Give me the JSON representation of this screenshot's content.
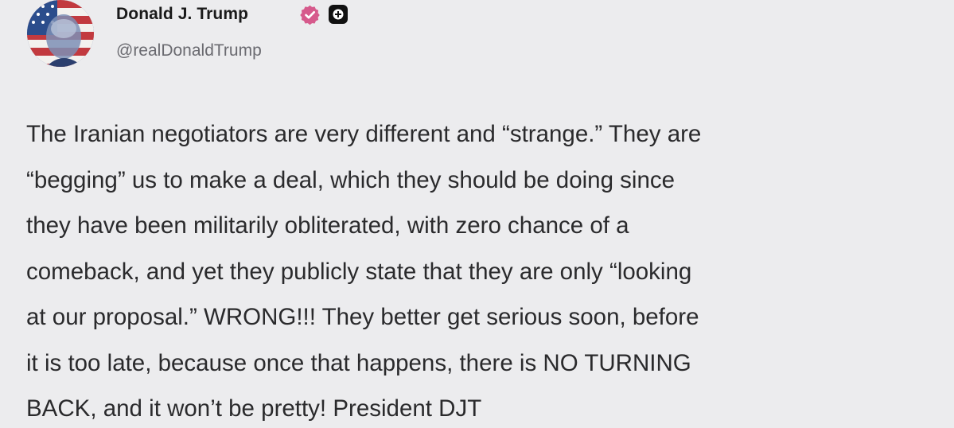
{
  "post": {
    "author_name": "Donald J. Trump",
    "handle": "@realDonaldTrump",
    "body_lines": [
      "The Iranian negotiators are very different and “strange.” They are",
      "“begging” us to make a deal, which they should be doing since",
      "they have been militarily obliterated, with zero chance of a",
      "comeback, and yet they publicly state that they are only “looking",
      "at our proposal.” WRONG!!! They better get serious soon, before",
      "it is too late, because once that happens, there is NO TURNING",
      "BACK, and it won’t be pretty! President DJT"
    ]
  },
  "icons": {
    "verified": "verified-badge-icon",
    "plus": "plus-badge-icon"
  },
  "colors": {
    "background": "#ececee",
    "verified_badge": "#d65a8c",
    "plus_badge": "#111111",
    "handle_text": "#6a6a70",
    "body_text": "#2a2a2c"
  }
}
